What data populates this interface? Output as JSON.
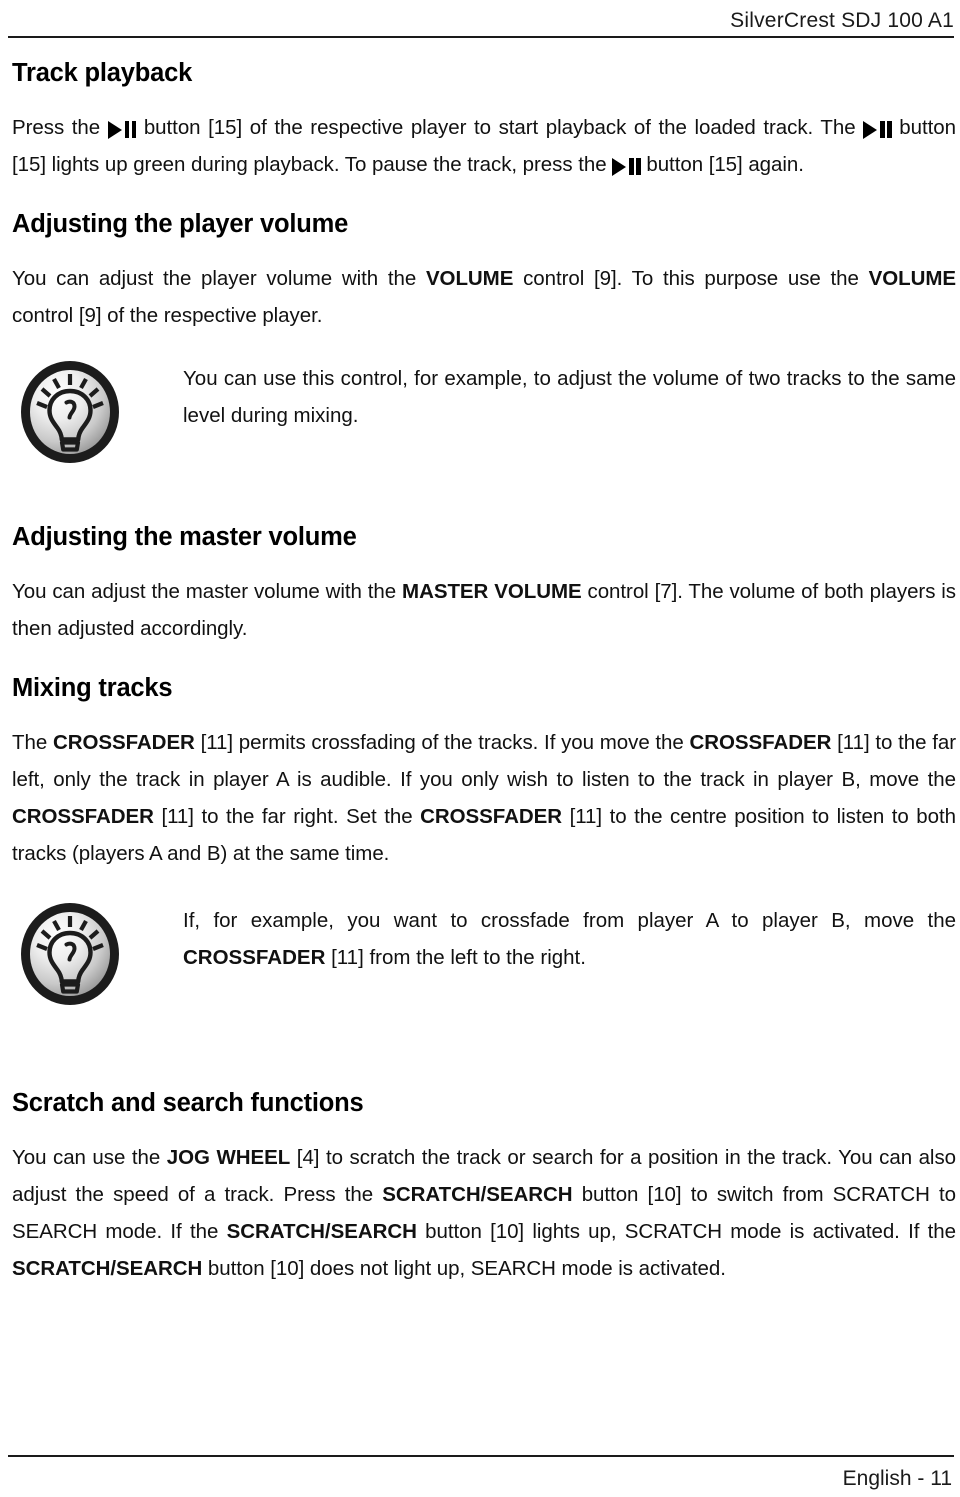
{
  "header": {
    "title": "SilverCrest SDJ 100 A1"
  },
  "footer": {
    "page_label": "English - 11"
  },
  "sections": [
    {
      "heading": "Track playback",
      "paragraph_part1": "Press the ",
      "paragraph_part2": " button [15] of the respective player to start playback of the loaded track. The ",
      "paragraph_part3": " button [15] lights up green during playback. To pause the track, press the ",
      "paragraph_part4": " button [15] again."
    },
    {
      "heading": "Adjusting the player volume",
      "p1_a": "You can adjust the player volume with the ",
      "p1_b": "VOLUME",
      "p1_c": " control [9]. To this purpose use the ",
      "p1_d": "VOLUME",
      "p1_e": " control [9] of the respective player.",
      "tip": "You can use this control, for example, to adjust the volume of two tracks to the same level during mixing."
    },
    {
      "heading": "Adjusting the master volume",
      "p1_a": "You can adjust the master volume with the ",
      "p1_b": "MASTER VOLUME",
      "p1_c": " control [7]. The volume of both players is then adjusted accordingly."
    },
    {
      "heading": "Mixing tracks",
      "p1_a": "The ",
      "p1_b": "CROSSFADER",
      "p1_c": " [11] permits crossfading of the tracks. If you move the ",
      "p1_d": "CROSSFADER",
      "p1_e": " [11] to the far left, only the track in player A is audible. If you only wish to listen to the track in player B, move the ",
      "p1_f": "CROSSFADER",
      "p1_g": " [11] to the far right. Set the ",
      "p1_h": "CROSSFADER",
      "p1_i": " [11] to the centre position to listen to both tracks (players A and B) at the same time.",
      "tip_a": "If, for example, you want to crossfade from player A to player B, move the ",
      "tip_b": "CROSSFADER",
      "tip_c": " [11] from the left to the right."
    },
    {
      "heading": "Scratch and search functions",
      "p1_a": "You can use the ",
      "p1_b": "JOG WHEEL",
      "p1_c": " [4] to scratch the track or search for a position in the track. You can also adjust the speed of a track. Press the ",
      "p1_d": "SCRATCH/SEARCH",
      "p1_e": " button [10] to switch from SCRATCH to SEARCH mode. If the ",
      "p1_f": "SCRATCH/SEARCH",
      "p1_g": " button [10] lights up, SCRATCH mode is activated. If the ",
      "p1_h": "SCRATCH/SEARCH",
      "p1_i": " button [10] does not light up, SEARCH mode is activated."
    }
  ],
  "icons": {
    "tip_icon_name": "lightbulb-tip-icon",
    "play_pause_glyph_name": "play-pause-glyph"
  },
  "colors": {
    "text": "#111111",
    "rule": "#1a1a1a",
    "icon_ring": "#1c1c1c",
    "icon_face_light": "#f2f2f2",
    "icon_face_dark": "#9a9a9a"
  }
}
